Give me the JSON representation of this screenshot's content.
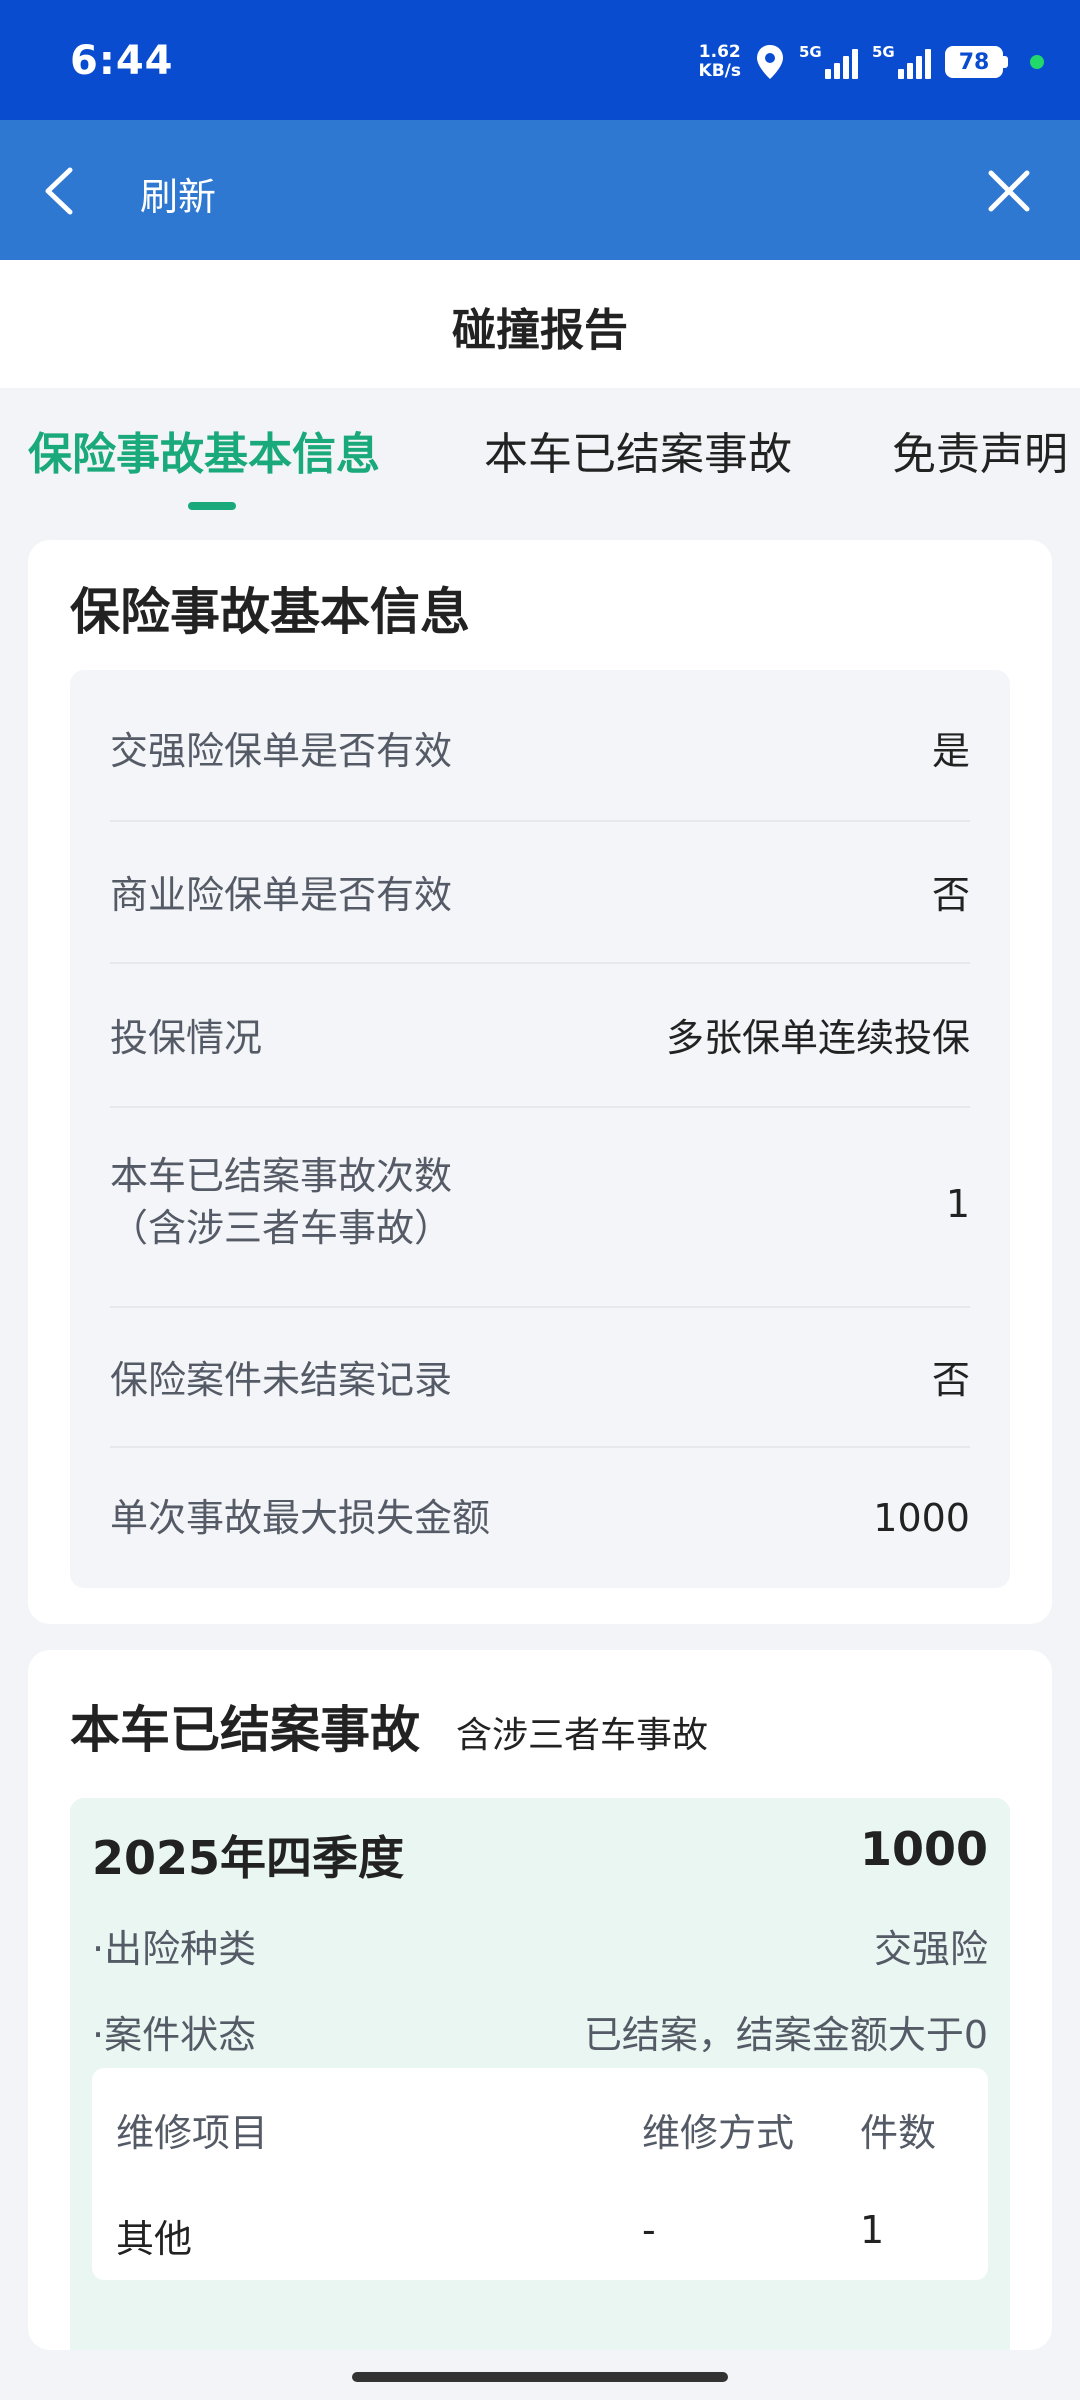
{
  "status_bar": {
    "time": "6:44",
    "net_speed_value": "1.62",
    "net_speed_unit": "KB/s",
    "sim1_label": "5G",
    "sim2_label": "5G",
    "battery": "78"
  },
  "app_bar": {
    "title": "刷新"
  },
  "page": {
    "title": "碰撞报告"
  },
  "tabs": [
    {
      "label": "保险事故基本信息",
      "active": true
    },
    {
      "label": "本车已结案事故",
      "active": false
    },
    {
      "label": "免责声明",
      "active": false
    }
  ],
  "basic_info": {
    "title": "保险事故基本信息",
    "rows": [
      {
        "label": "交强险保单是否有效",
        "value": "是"
      },
      {
        "label": "商业险保单是否有效",
        "value": "否"
      },
      {
        "label": "投保情况",
        "value": "多张保单连续投保"
      },
      {
        "label": "本车已结案事故次数",
        "label_line2": "（含涉三者车事故）",
        "value": "1"
      },
      {
        "label": "保险案件未结案记录",
        "value": "否"
      },
      {
        "label": "单次事故最大损失金额",
        "value": "1000"
      }
    ]
  },
  "closed_claims": {
    "title": "本车已结案事故",
    "subtitle": "含涉三者车事故",
    "items": [
      {
        "period": "2025年四季度",
        "amount": "1000",
        "details": [
          {
            "label": "·出险种类",
            "value": "交强险"
          },
          {
            "label": "·案件状态",
            "value": "已结案，结案金额大于0"
          }
        ],
        "repair_headers": [
          "维修项目",
          "维修方式",
          "件数"
        ],
        "repair_rows": [
          [
            "其他",
            "-",
            "1"
          ]
        ]
      }
    ]
  },
  "colors": {
    "status_bar": "#0a4ccf",
    "app_bar": "#2f78d2",
    "accent": "#1aa97a",
    "background": "#f3f4f7",
    "claim_box": "#eaf6f2"
  }
}
